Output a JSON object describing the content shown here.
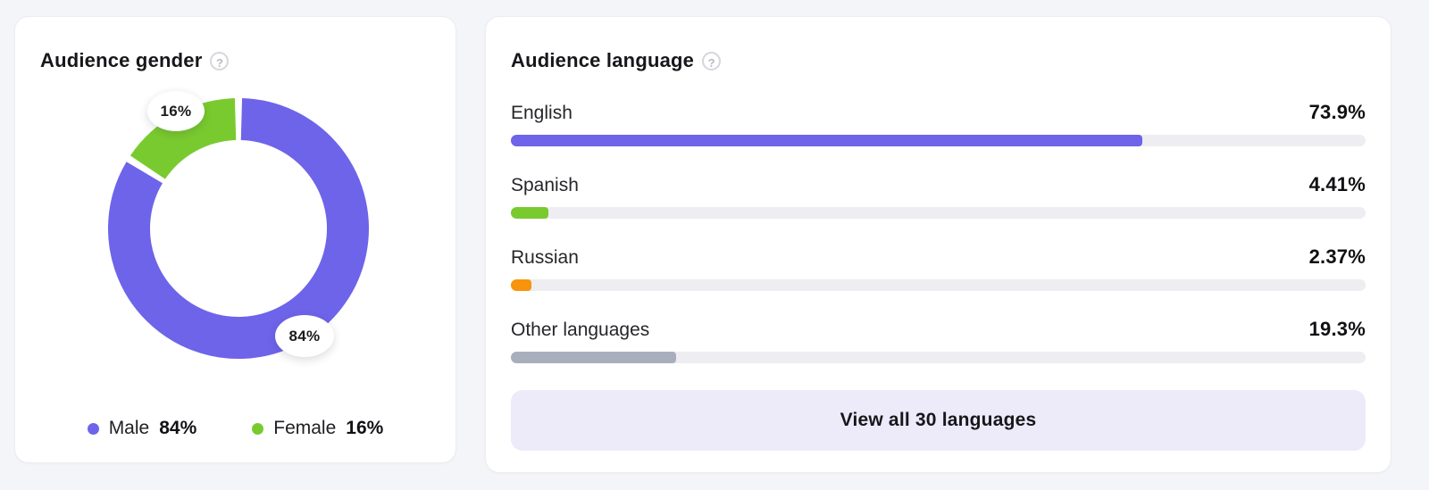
{
  "page": {
    "background": "#f4f5f9"
  },
  "gender_card": {
    "title": "Audience gender",
    "help_icon": {
      "name": "question-circle",
      "glyph": "?"
    },
    "legend": [
      {
        "label": "Male",
        "value": "84%"
      },
      {
        "label": "Female",
        "value": "16%"
      }
    ]
  },
  "language_card": {
    "title": "Audience language",
    "help_icon": {
      "name": "question-circle",
      "glyph": "?"
    },
    "button_label": "View all 30 languages",
    "button_bg": "#edebfa"
  },
  "chart_data": [
    {
      "type": "pie",
      "variant": "donut",
      "title": "Audience gender",
      "series": [
        {
          "name": "Male",
          "value": 84,
          "percent_label": "84%",
          "color": "#6d64ea"
        },
        {
          "name": "Female",
          "value": 16,
          "percent_label": "16%",
          "color": "#79ca2f"
        }
      ],
      "start_angle_deg": 0,
      "direction": "clockwise",
      "inner_radius_ratio": 0.68,
      "slice_gap_deg": 1.6,
      "legend_position": "bottom"
    },
    {
      "type": "bar",
      "orientation": "horizontal",
      "title": "Audience language",
      "categories": [
        "English",
        "Spanish",
        "Russian",
        "Other languages"
      ],
      "values": [
        73.9,
        4.41,
        2.37,
        19.3
      ],
      "value_labels": [
        "73.9%",
        "4.41%",
        "2.37%",
        "19.3%"
      ],
      "colors": [
        "#6d64ea",
        "#79ca2f",
        "#f7930d",
        "#a9aebc"
      ],
      "track_color": "#ededf2",
      "xlim": [
        0,
        100
      ],
      "grid": false
    }
  ]
}
